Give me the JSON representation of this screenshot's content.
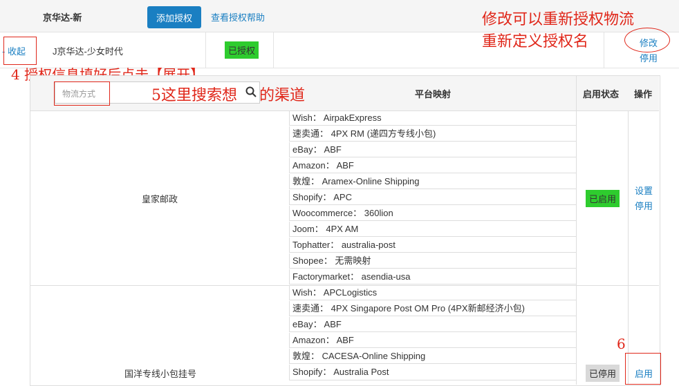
{
  "header": {
    "title": "京华达-新",
    "add_button": "添加授权",
    "help_link": "查看授权帮助"
  },
  "account_row": {
    "collapse_link": "- 收起",
    "account_name": "J京华达-少女时代",
    "auth_badge": "已授权",
    "edit_link": "修改",
    "disable_link": "停用"
  },
  "annotations": {
    "note_edit_line1": "修改可以重新授权物流",
    "note_edit_line2": "重新定义授权名",
    "note_step4": "4 授权信息填好后点击【展开】",
    "note_step5": "5这里搜索想",
    "note_step5b": "的渠道",
    "note_step6": "6"
  },
  "table": {
    "search_placeholder": "物流方式",
    "col_mapping": "平台映射",
    "col_status": "启用状态",
    "col_action": "操作",
    "rows": [
      {
        "name": "皇家邮政",
        "status": "已启用",
        "action1": "设置",
        "action2": "停用",
        "mappings": [
          {
            "text": "Wish： AirpakExpress"
          },
          {
            "text": "速卖通： 4PX RM (递四方专线小包)"
          },
          {
            "text": "eBay： ABF"
          },
          {
            "text": "Amazon： ABF"
          },
          {
            "text": "敦煌： Aramex-Online Shipping"
          },
          {
            "text": "Shopify： APC"
          },
          {
            "text": "Woocommerce： 360lion"
          },
          {
            "text": "Joom： 4PX AM"
          },
          {
            "text": "Tophatter： australia-post"
          },
          {
            "text": "Shopee： 无需映射"
          },
          {
            "text": "Factorymarket： asendia-usa"
          }
        ]
      },
      {
        "name": "国洋专线小包挂号",
        "status": "已停用",
        "action1": "启用",
        "mappings": [
          {
            "text": "Wish： APCLogistics"
          },
          {
            "text": "速卖通： 4PX Singapore Post OM Pro (4PX新邮经济小包)"
          },
          {
            "text": "eBay： ABF"
          },
          {
            "text": "Amazon： ABF"
          },
          {
            "text": "敦煌： CACESA-Online Shipping"
          },
          {
            "text": "Shopify： Australia Post"
          }
        ]
      }
    ]
  }
}
